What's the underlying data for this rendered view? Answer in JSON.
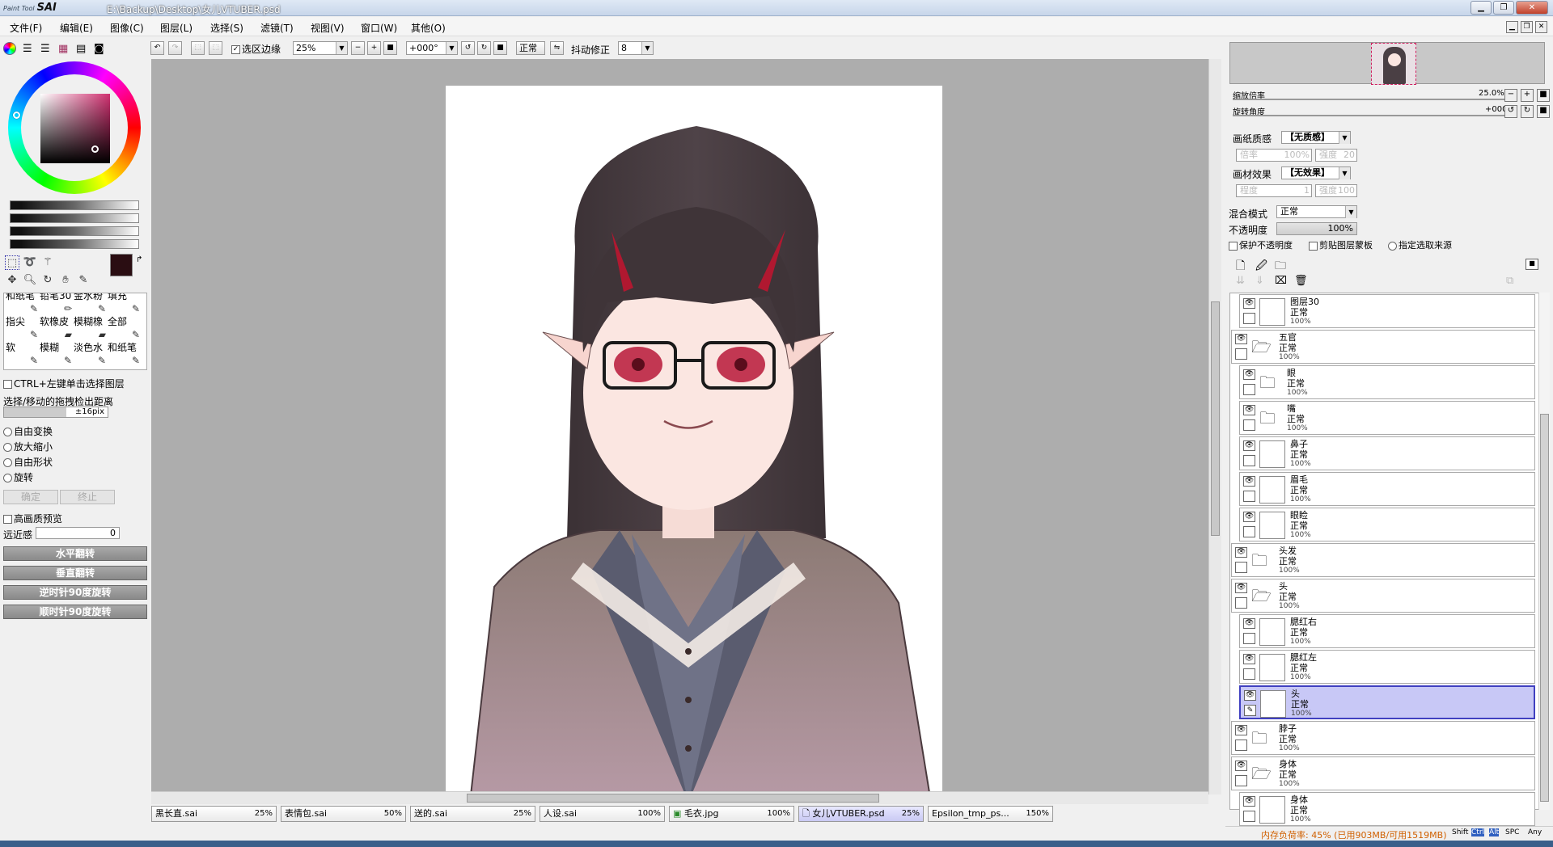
{
  "window": {
    "app_name": "PaintTool SAI",
    "logo_small": "Paint Tool",
    "logo_big": "SAI",
    "file_path": "E:\\Backup\\Desktop\\女儿VTUBER.psd",
    "controls": [
      "▁",
      "❐",
      "✕"
    ]
  },
  "menu": [
    "文件(F)",
    "编辑(E)",
    "图像(C)",
    "图层(L)",
    "选择(S)",
    "滤镜(T)",
    "视图(V)",
    "窗口(W)",
    "其他(O)"
  ],
  "toolbar": {
    "selection_edge_label": "选区边缘",
    "zoom": "25%",
    "angle": "+000°",
    "blend": "正常",
    "stabilizer_label": "抖动修正",
    "stabilizer_value": "8"
  },
  "colors": {
    "current_fg": "#2a0d12",
    "current_bg": "#ffffff",
    "accent_selected": "#c8c8f6"
  },
  "brushes": [
    {
      "name": "和纸笔"
    },
    {
      "name": "铅笔30"
    },
    {
      "name": "金水粉"
    },
    {
      "name": "填充"
    },
    {
      "name": "指尖"
    },
    {
      "name": "软橡皮"
    },
    {
      "name": "模糊橡"
    },
    {
      "name": "全部"
    },
    {
      "name": "软"
    },
    {
      "name": "模糊"
    },
    {
      "name": "淡色水"
    },
    {
      "name": "和纸笔"
    }
  ],
  "transform": {
    "ctrl_click_label": "CTRL+左键单击选择图层",
    "drag_distance_label": "选择/移动的拖拽检出距离",
    "drag_distance_value": "±16pix",
    "modes": [
      "自由变换",
      "放大缩小",
      "自由形状",
      "旋转"
    ],
    "ok": "确定",
    "cancel": "终止",
    "hq_preview": "高画质预览",
    "perspective_label": "远近感",
    "perspective_value": "0",
    "flip_h": "水平翻转",
    "flip_v": "垂直翻转",
    "rot_ccw": "逆时针90度旋转",
    "rot_cw": "顺时针90度旋转"
  },
  "file_tabs": [
    {
      "name": "黑长直.sai",
      "zoom": "25%"
    },
    {
      "name": "表情包.sai",
      "zoom": "50%"
    },
    {
      "name": "送的.sai",
      "zoom": "25%"
    },
    {
      "name": "人设.sai",
      "zoom": "100%"
    },
    {
      "name": "毛衣.jpg",
      "zoom": "100%"
    },
    {
      "name": "女儿VTUBER.psd",
      "zoom": "25%"
    },
    {
      "name": "Epsilon_tmp_ps...",
      "zoom": "150%"
    }
  ],
  "navigator": {
    "zoom_label": "缩放倍率",
    "zoom_value": "25.0%",
    "rotate_label": "旋转角度",
    "rotate_value": "+000"
  },
  "layer_props": {
    "paper_label": "画纸质感",
    "paper_value": "【无质感】",
    "scale_label": "倍率",
    "scale_value": "100%",
    "strength_label": "强度",
    "strength_value": "20",
    "effect_label": "画材效果",
    "effect_value": "【无效果】",
    "degree_label": "程度",
    "degree_value": "1",
    "strength2_value": "100",
    "blend_label": "混合模式",
    "blend_value": "正常",
    "opacity_label": "不透明度",
    "opacity_value": "100%",
    "protect_opacity": "保护不透明度",
    "clip_mask": "剪贴图层蒙板",
    "sel_source": "指定选取来源"
  },
  "layers": [
    {
      "name": "图层30",
      "mode": "正常",
      "opacity": "100%",
      "type": "layer",
      "indent": 1
    },
    {
      "name": "五官",
      "mode": "正常",
      "opacity": "100%",
      "type": "folder-open",
      "indent": 0
    },
    {
      "name": "眼",
      "mode": "正常",
      "opacity": "100%",
      "type": "folder",
      "indent": 1
    },
    {
      "name": "嘴",
      "mode": "正常",
      "opacity": "100%",
      "type": "folder",
      "indent": 1
    },
    {
      "name": "鼻子",
      "mode": "正常",
      "opacity": "100%",
      "type": "layer",
      "indent": 1
    },
    {
      "name": "眉毛",
      "mode": "正常",
      "opacity": "100%",
      "type": "layer",
      "indent": 1
    },
    {
      "name": "眼睑",
      "mode": "正常",
      "opacity": "100%",
      "type": "layer",
      "indent": 1
    },
    {
      "name": "头发",
      "mode": "正常",
      "opacity": "100%",
      "type": "folder",
      "indent": 0
    },
    {
      "name": "头",
      "mode": "正常",
      "opacity": "100%",
      "type": "folder-open",
      "indent": 0
    },
    {
      "name": "腮红右",
      "mode": "正常",
      "opacity": "100%",
      "type": "layer",
      "indent": 1
    },
    {
      "name": "腮红左",
      "mode": "正常",
      "opacity": "100%",
      "type": "layer",
      "indent": 1
    },
    {
      "name": "头",
      "mode": "正常",
      "opacity": "100%",
      "type": "layer",
      "indent": 1,
      "selected": true
    },
    {
      "name": "脖子",
      "mode": "正常",
      "opacity": "100%",
      "type": "folder",
      "indent": 0
    },
    {
      "name": "身体",
      "mode": "正常",
      "opacity": "100%",
      "type": "folder-open",
      "indent": 0
    },
    {
      "name": "身体",
      "mode": "正常",
      "opacity": "100%",
      "type": "layer",
      "indent": 1
    }
  ],
  "status": {
    "memory": "内存负荷率: 45% (已用903MB/可用1519MB)",
    "keys": [
      "Shift",
      "Ctrl",
      "Alt",
      "SPC",
      "Any"
    ]
  }
}
